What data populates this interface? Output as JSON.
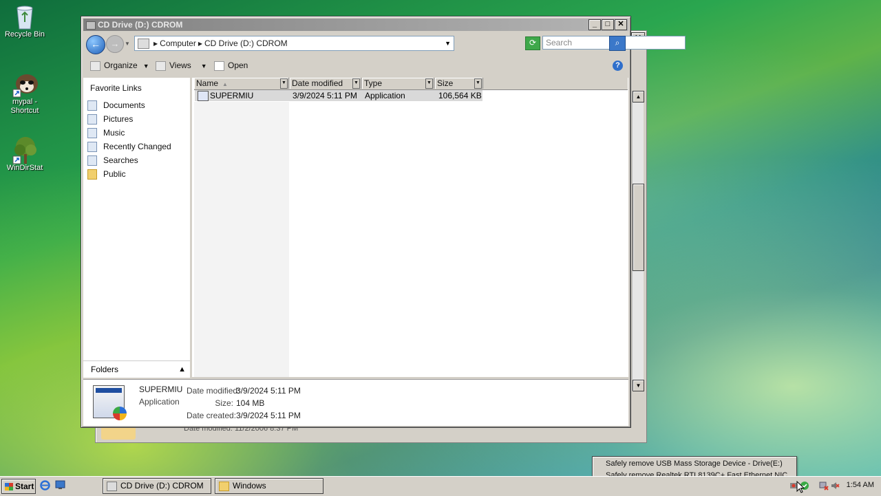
{
  "desktop": {
    "icons": [
      {
        "label": "Recycle Bin"
      },
      {
        "label": "mypal - Shortcut"
      },
      {
        "label": "WinDirStat"
      }
    ]
  },
  "back_window": {
    "detail_fragment": "Date modified: 11/2/2006 8:37 PM"
  },
  "window": {
    "title": "CD Drive (D:) CDROM",
    "controls": {
      "minimize": "_",
      "maximize": "□",
      "close": "✕"
    },
    "address": {
      "crumbs": [
        "Computer",
        "CD Drive (D:) CDROM"
      ]
    },
    "search": {
      "placeholder": "Search"
    },
    "toolbar": {
      "organize": "Organize",
      "views": "Views",
      "open": "Open",
      "help": "?"
    },
    "nav_pane": {
      "header": "Favorite Links",
      "items": [
        {
          "label": "Documents",
          "icon": "documents-icon"
        },
        {
          "label": "Pictures",
          "icon": "pictures-icon"
        },
        {
          "label": "Music",
          "icon": "music-icon"
        },
        {
          "label": "Recently Changed",
          "icon": "recent-icon"
        },
        {
          "label": "Searches",
          "icon": "search-icon"
        },
        {
          "label": "Public",
          "icon": "folder-icon"
        }
      ],
      "folders_label": "Folders"
    },
    "file_list": {
      "columns": [
        "Name",
        "Date modified",
        "Type",
        "Size"
      ],
      "rows": [
        {
          "name": "SUPERMIU",
          "date_modified": "3/9/2024 5:11 PM",
          "type": "Application",
          "size": "106,564 KB"
        }
      ]
    },
    "details": {
      "name": "SUPERMIU",
      "type": "Application",
      "date_modified_label": "Date modified:",
      "date_modified": "3/9/2024 5:11 PM",
      "size_label": "Size:",
      "size": "104 MB",
      "date_created_label": "Date created:",
      "date_created": "3/9/2024 5:11 PM"
    }
  },
  "taskbar": {
    "start": "Start",
    "tasks": [
      {
        "label": "CD Drive (D:) CDROM"
      },
      {
        "label": "Windows"
      }
    ],
    "clock": "1:54 AM"
  },
  "tray_menu": {
    "items": [
      "Safely remove USB Mass Storage Device - Drive(E:)",
      "Safely remove Realtek RTL8139C+ Fast Ethernet NIC"
    ]
  }
}
